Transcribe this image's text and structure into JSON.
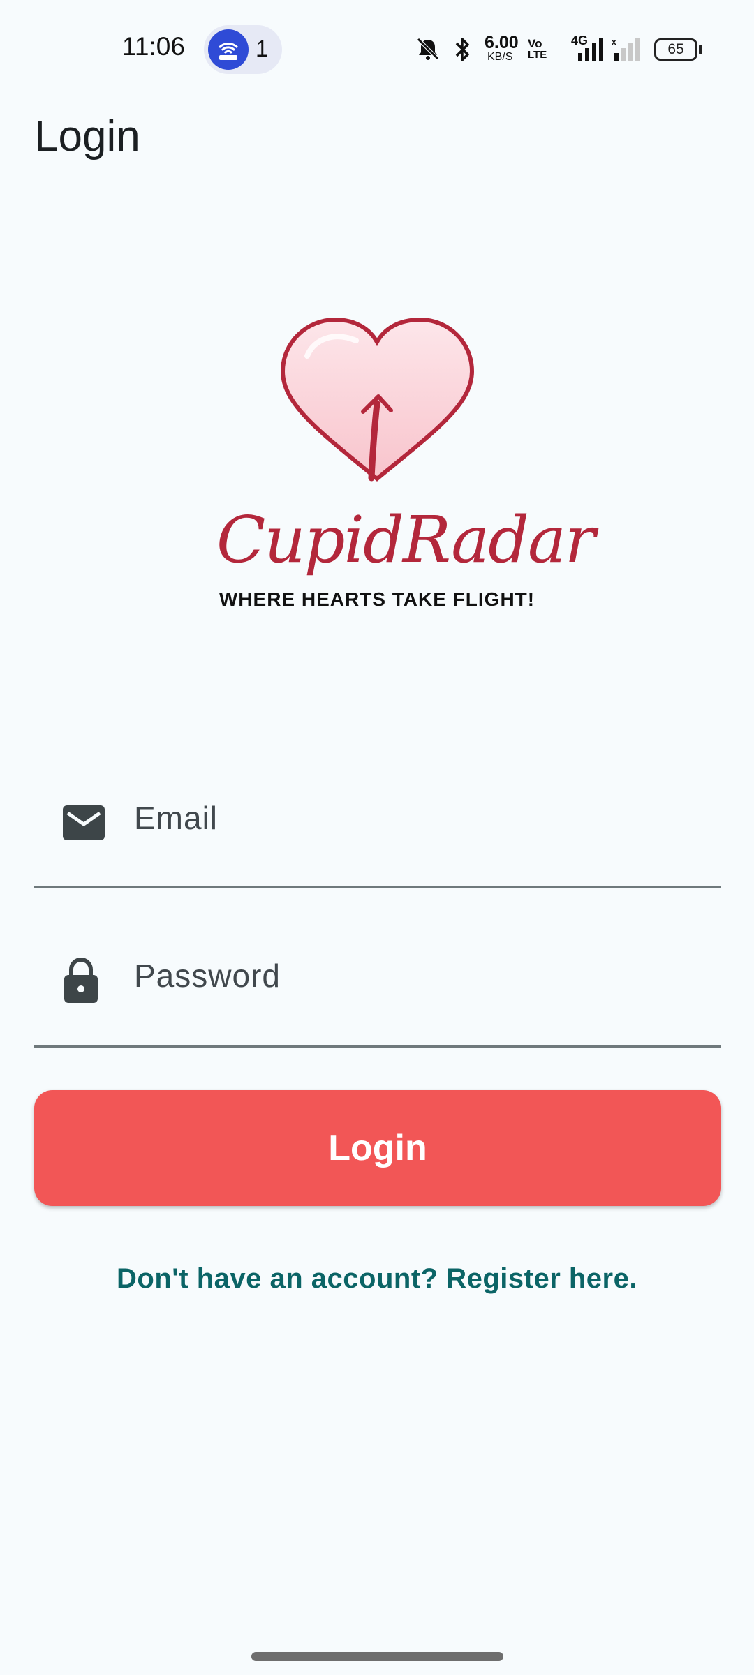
{
  "status_bar": {
    "time": "11:06",
    "hotspot_count": "1",
    "network_speed_value": "6.00",
    "network_speed_unit": "KB/S",
    "volte_line1": "Vo",
    "volte_line2": "LTE",
    "network_type": "4G",
    "battery_level": "65",
    "icons": [
      "hotspot-icon",
      "mute-bell-icon",
      "bluetooth-icon",
      "signal-icon",
      "signal-weak-icon",
      "battery-icon"
    ]
  },
  "app_bar": {
    "title": "Login"
  },
  "logo": {
    "brand_name": "CupidRadar",
    "tagline": "WHERE HEARTS TAKE FLIGHT!",
    "colors": {
      "heart_fill": "#fbd3d9",
      "heart_stroke": "#b3273b",
      "brand_text": "#b3273b"
    }
  },
  "form": {
    "email": {
      "placeholder": "Email",
      "icon": "mail-icon"
    },
    "password": {
      "placeholder": "Password",
      "icon": "lock-icon"
    },
    "login_button_label": "Login",
    "register_link": "Don't have an account? Register here."
  },
  "colors": {
    "background": "#f7fbfd",
    "primary_button": "#f25656",
    "link": "#0b6466"
  }
}
